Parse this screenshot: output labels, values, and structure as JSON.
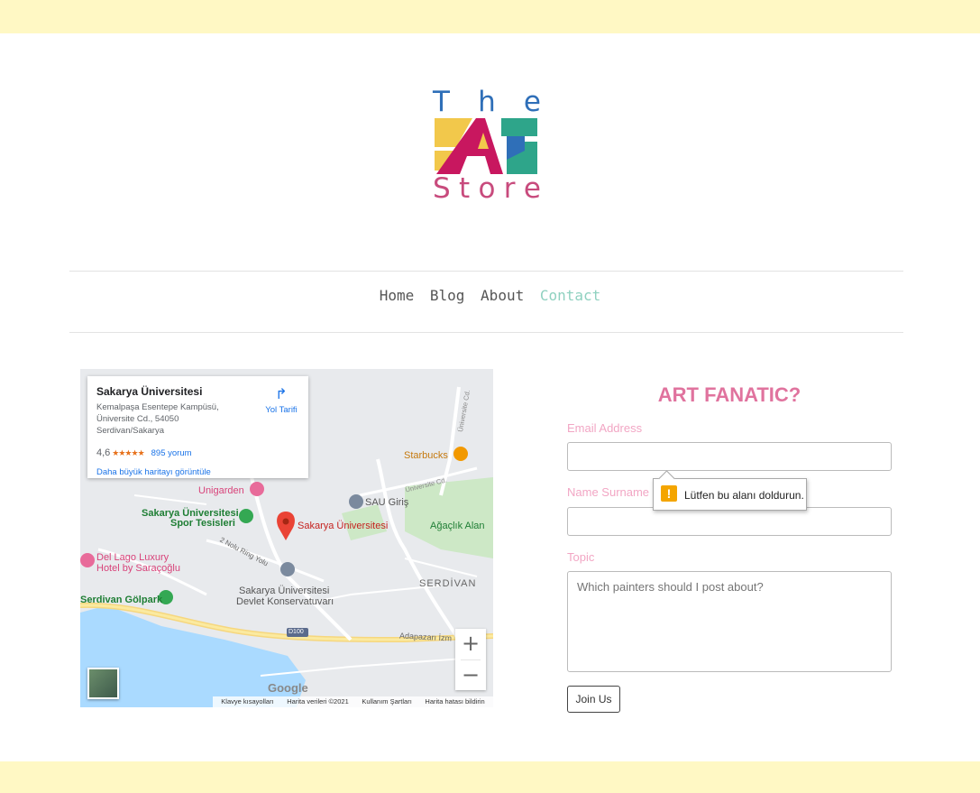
{
  "logo": {
    "line1": [
      "T",
      "h",
      "e"
    ],
    "line2": "Art",
    "line3": [
      "S",
      "t",
      "o",
      "r",
      "e"
    ],
    "colors": {
      "blue": "#2f6fb8",
      "yellow": "#f2c84b",
      "magenta": "#c8175f",
      "teal": "#2ea58a",
      "pink": "#c84b7d"
    }
  },
  "nav": {
    "items": [
      {
        "label": "Home"
      },
      {
        "label": "Blog"
      },
      {
        "label": "About"
      },
      {
        "label": "Contact",
        "active": true
      }
    ]
  },
  "map": {
    "card": {
      "name": "Sakarya Üniversitesi",
      "address": "Kemalpaşa Esentepe Kampüsü, Üniversite Cd., 54050 Serdivan/Sakarya",
      "rating": "4,6",
      "stars": "★★★★★",
      "reviews": "895 yorum",
      "bigger_map": "Daha büyük haritayı görüntüle",
      "directions": "Yol Tarifi"
    },
    "labels": {
      "starbucks": "Starbucks",
      "unigarden": "Unigarden",
      "sau_giris": "SAU Giriş",
      "spor_1": "Sakarya Üniversitesi",
      "spor_2": "Spor Tesisleri",
      "sakarya_univ": "Sakarya Üniversitesi",
      "agaclik": "Ağaçlık Alan",
      "del_lago_1": "Del Lago Luxury",
      "del_lago_2": "Hotel by Saraçoğlu",
      "ring_yolu": "2 Nolu Ring Yolu",
      "konservatuvar_1": "Sakarya Üniversitesi",
      "konservatuvar_2": "Devlet Konservatuvarı",
      "serdivan": "SERDİVAN",
      "golpark": "Serdivan Gölpark",
      "d100": "D100",
      "adapazari": "Adapazarı İzm",
      "universite_cd": "Üniversite Cd.",
      "universite_cd2": "Üniversite Cd."
    },
    "google": "Google",
    "attribution": [
      "Klavye kısayolları",
      "Harita verileri ©2021",
      "Kullanım Şartları",
      "Harita hatası bildirin"
    ],
    "zoom_in": "+",
    "zoom_out": "−"
  },
  "form": {
    "title": "ART FANATIC?",
    "email_label": "Email Address",
    "email_value": "",
    "name_label": "Name Surname",
    "name_value": "",
    "topic_label": "Topic",
    "topic_placeholder": "Which painters should I post about?",
    "submit": "Join Us",
    "validation_message": "Lütfen bu alanı doldurun.",
    "validation_icon": "!"
  }
}
